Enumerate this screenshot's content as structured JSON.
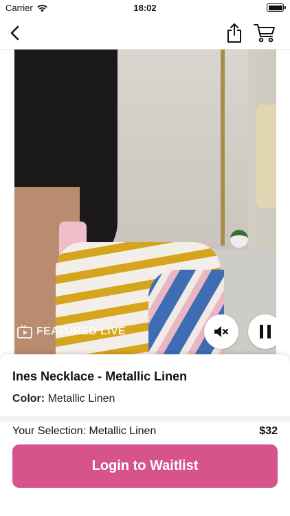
{
  "status_bar": {
    "carrier": "Carrier",
    "time": "18:02"
  },
  "nav": {
    "back_icon": "chevron-left-icon",
    "share_icon": "share-icon",
    "cart_icon": "cart-icon"
  },
  "video": {
    "overlay_label": "FEATURED LIVE",
    "mute_icon": "speaker-muted-icon",
    "pause_icon": "pause-icon"
  },
  "product": {
    "title": "Ines Necklace - Metallic Linen",
    "color_label": "Color:",
    "color_value": "Metallic Linen",
    "selection_text": "Your Selection: Metallic Linen",
    "price": "$32",
    "cta_label": "Login to Waitlist"
  },
  "colors": {
    "accent": "#d6538c"
  }
}
